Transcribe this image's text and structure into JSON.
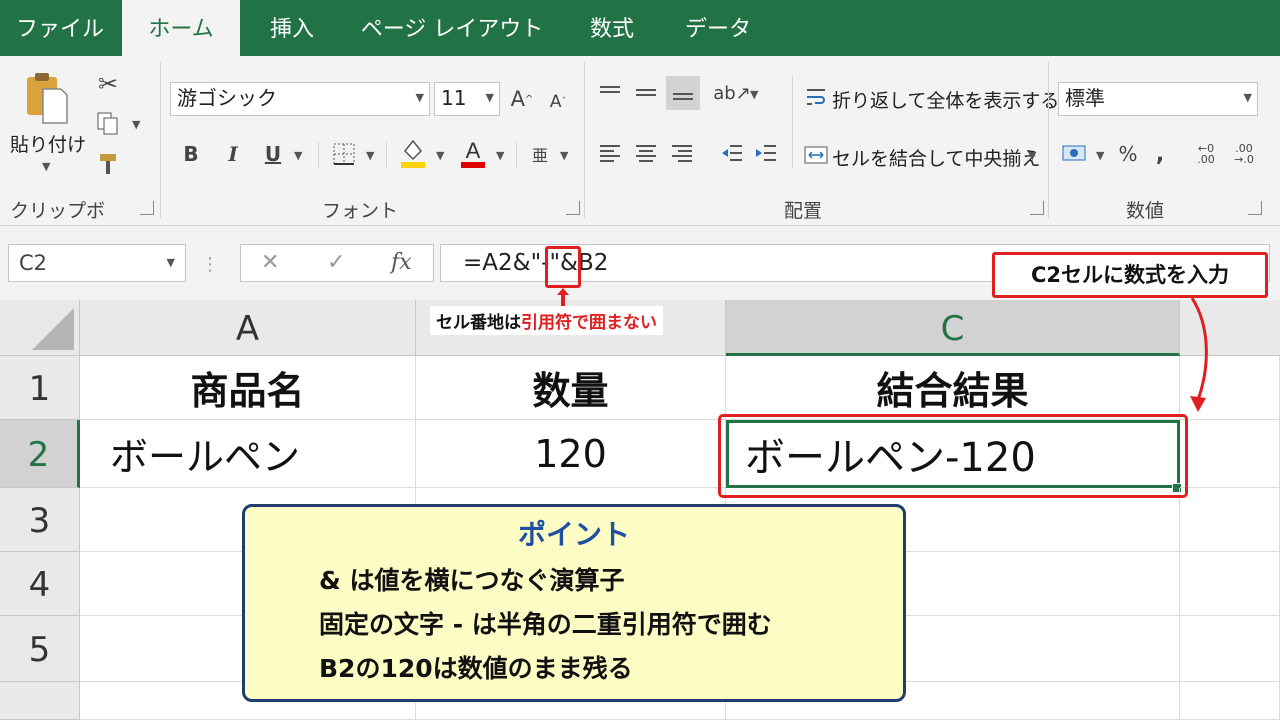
{
  "tabs": [
    {
      "label": "ファイル",
      "active": false
    },
    {
      "label": "ホーム",
      "active": true
    },
    {
      "label": "挿入",
      "active": false
    },
    {
      "label": "ページ レイアウト",
      "active": false
    },
    {
      "label": "数式",
      "active": false
    },
    {
      "label": "データ",
      "active": false
    }
  ],
  "ribbon": {
    "clipboard": {
      "paste_label": "貼り付け",
      "group_label": "クリップボード"
    },
    "font": {
      "font_name": "游ゴシック",
      "font_size": "11",
      "group_label": "フォント"
    },
    "alignment": {
      "wrap_text_label": "折り返して全体を表示する",
      "merge_center_label": "セルを結合して中央揃え",
      "group_label": "配置"
    },
    "number": {
      "format": "標準",
      "group_label": "数値"
    }
  },
  "formula_bar": {
    "name_box": "C2",
    "formula": "=A2&\"-\"&B2"
  },
  "grid": {
    "columns": [
      "A",
      "",
      "C"
    ],
    "rows": [
      "1",
      "2",
      "3",
      "4",
      "5"
    ],
    "selected_cell": "C2",
    "cells": {
      "A1": "商品名",
      "B1": "数量",
      "C1": "結合結果",
      "A2": "ボールペン",
      "B2": "120",
      "C2": "ボールペン-120"
    }
  },
  "annotations": {
    "callout_title": "C2セルに数式を入力",
    "note_prefix": "セル番地は",
    "note_highlight": "引用符で囲まない",
    "accent_color": "#e02020"
  },
  "point": {
    "title": "ポイント",
    "lines": [
      "& は値を横につなぐ演算子",
      "固定の文字 - は半角の二重引用符で囲む",
      "B2の120は数値のまま残る"
    ]
  },
  "colors": {
    "excel_green": "#217346",
    "point_bg": "#fdfcc4",
    "point_border": "#1f3d6e",
    "point_title": "#1f4fa0"
  }
}
